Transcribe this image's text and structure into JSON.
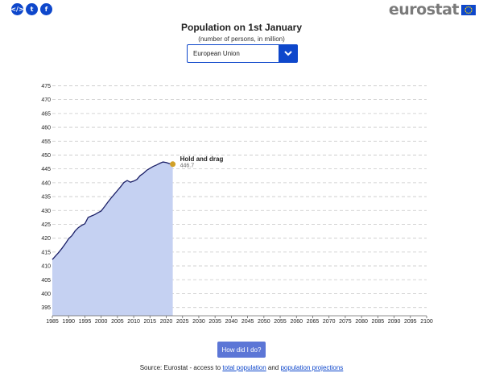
{
  "share": {
    "embed_label": "</>",
    "twitter_label": "t",
    "facebook_label": "f"
  },
  "logo": {
    "text": "eurostat"
  },
  "header": {
    "title": "Population on 1st January",
    "subtitle": "(number of persons, in million)"
  },
  "selector": {
    "value": "European Union"
  },
  "chart_data": {
    "type": "area",
    "title": "Population on 1st January",
    "subtitle": "(number of persons, in million)",
    "xlim": [
      1985,
      2100
    ],
    "ylim": [
      392,
      476
    ],
    "x_ticks": [
      1985,
      1990,
      1995,
      2000,
      2005,
      2010,
      2015,
      2020,
      2025,
      2030,
      2035,
      2040,
      2045,
      2050,
      2055,
      2060,
      2065,
      2070,
      2075,
      2080,
      2085,
      2090,
      2095,
      2100
    ],
    "y_ticks": [
      395,
      400,
      405,
      410,
      415,
      420,
      425,
      430,
      435,
      440,
      445,
      450,
      455,
      460,
      465,
      470,
      475
    ],
    "grid": true,
    "series": [
      {
        "x": [
          1985,
          1986,
          1987,
          1988,
          1989,
          1990,
          1991,
          1992,
          1993,
          1994,
          1995,
          1996,
          1997,
          1998,
          1999,
          2000,
          2001,
          2002,
          2003,
          2004,
          2005,
          2006,
          2007,
          2008,
          2009,
          2010,
          2011,
          2012,
          2013,
          2014,
          2015,
          2016,
          2017,
          2018,
          2019,
          2020,
          2021,
          2022
        ],
        "y": [
          412.3,
          413.6,
          414.9,
          416.4,
          418.0,
          419.8,
          420.9,
          422.6,
          423.8,
          424.6,
          425.2,
          427.5,
          428.0,
          428.5,
          429.2,
          429.8,
          431.3,
          432.9,
          434.4,
          435.8,
          437.2,
          438.6,
          440.1,
          440.8,
          440.2,
          440.6,
          441.2,
          442.6,
          443.4,
          444.5,
          445.2,
          445.9,
          446.4,
          447.0,
          447.5,
          447.3,
          446.9,
          446.7
        ]
      }
    ],
    "annotation": {
      "label": "Hold and drag",
      "value": "446.7",
      "x": 2022,
      "y": 446.7
    },
    "colors": {
      "fill": "#c5d1f2",
      "line": "#1a1e66",
      "marker": "#d1a027",
      "grid": "#c8c8c8"
    }
  },
  "action": {
    "label": "How did I do?"
  },
  "source": {
    "prefix": "Source: Eurostat - access to ",
    "link1": "total population",
    "middle": " and ",
    "link2": "population projections"
  }
}
